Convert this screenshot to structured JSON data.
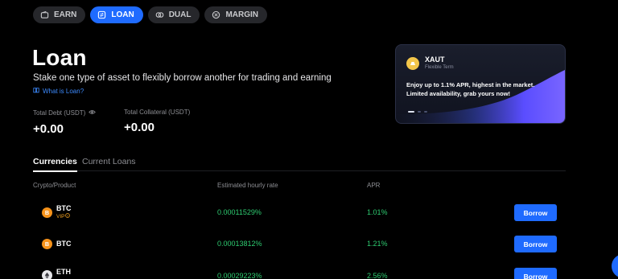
{
  "nav": {
    "pills": [
      {
        "label": "EARN",
        "icon": "wallet-icon",
        "active": false
      },
      {
        "label": "LOAN",
        "icon": "exchange-icon",
        "active": true
      },
      {
        "label": "DUAL",
        "icon": "dual-icon",
        "active": false
      },
      {
        "label": "MARGIN",
        "icon": "margin-icon",
        "active": false
      }
    ]
  },
  "header": {
    "title": "Loan",
    "subtitle": "Stake one type of asset to flexibly borrow another for trading and earning",
    "what_link": "What is Loan?"
  },
  "stats": {
    "total_debt_label": "Total Debt (USDT)",
    "total_debt_value": "+0.00",
    "total_collateral_label": "Total Collateral (USDT)",
    "total_collateral_value": "+0.00"
  },
  "promo": {
    "coin": "XAUT",
    "term": "Flexible Term",
    "text": "Enjoy up to 1.1% APR, highest in the market. Limited availability, grab yours now!"
  },
  "tabs": [
    {
      "label": "Currencies",
      "active": true
    },
    {
      "label": "Current Loans",
      "active": false
    }
  ],
  "table": {
    "headers": {
      "product": "Crypto/Product",
      "rate": "Estimated hourly rate",
      "apr": "APR"
    },
    "rows": [
      {
        "symbol": "BTC",
        "vip": "VIP",
        "rate": "0.00011529%",
        "apr": "1.01%",
        "action": "Borrow",
        "icon": "btc-icon"
      },
      {
        "symbol": "BTC",
        "vip": "",
        "rate": "0.00013812%",
        "apr": "1.21%",
        "action": "Borrow",
        "icon": "btc-icon"
      },
      {
        "symbol": "ETH",
        "vip": "",
        "rate": "0.00029223%",
        "apr": "2.56%",
        "action": "Borrow",
        "icon": "eth-icon"
      }
    ]
  },
  "colors": {
    "accent": "#1f6bff",
    "positive": "#2ecc71",
    "vip": "#f0a020"
  }
}
